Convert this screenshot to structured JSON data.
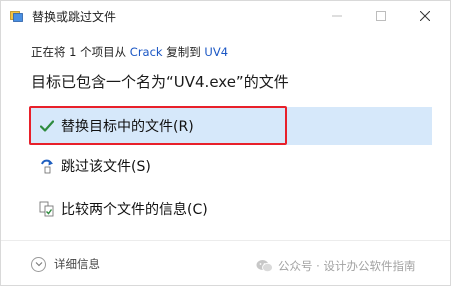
{
  "window": {
    "title": "替换或跳过文件",
    "minimize_icon": "minimize-icon",
    "maximize_icon": "maximize-icon",
    "close_icon": "close-icon"
  },
  "source": {
    "prefix": "正在将 1 个项目从 ",
    "from": "Crack",
    "middle": " 复制到 ",
    "to": "UV4",
    "link_color": "#1a56c4"
  },
  "heading": "目标已包含一个名为“UV4.exe”的文件",
  "options": [
    {
      "label": "替换目标中的文件(R)",
      "icon": "checkmark-icon",
      "selected": true
    },
    {
      "label": "跳过该文件(S)",
      "icon": "skip-icon",
      "selected": false
    },
    {
      "label": "比较两个文件的信息(C)",
      "icon": "compare-icon",
      "selected": false
    }
  ],
  "footer": {
    "details_label": "详细信息",
    "details_icon": "chevron-down-icon"
  },
  "watermark": {
    "text": "公众号 · 设计办公软件指南",
    "icon": "wechat-icon"
  },
  "colors": {
    "selected_bg": "#d6e8fa",
    "highlight_border": "#e8202a",
    "check_green": "#2e8b3e",
    "skip_blue": "#1f5fbf"
  }
}
